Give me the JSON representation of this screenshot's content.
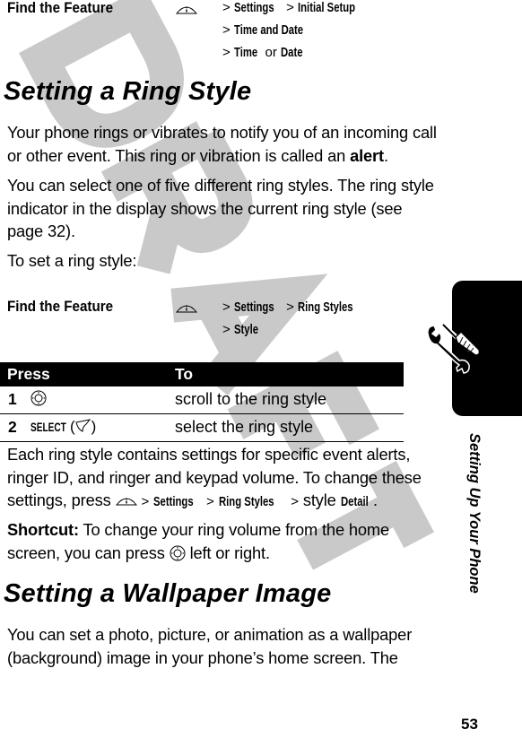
{
  "find_feature_1": {
    "label": "Find the Feature",
    "icon": "menu-key-icon",
    "lines": [
      [
        {
          "t": "gt",
          "v": ">"
        },
        {
          "t": "key",
          "v": "Settings"
        },
        {
          "t": "gt",
          "v": ">"
        },
        {
          "t": "key",
          "v": "Initial Setup"
        }
      ],
      [
        {
          "t": "gt",
          "v": ">"
        },
        {
          "t": "key",
          "v": "Time and Date"
        }
      ],
      [
        {
          "t": "gt",
          "v": ">"
        },
        {
          "t": "key",
          "v": "Time"
        },
        {
          "t": "or",
          "v": "or"
        },
        {
          "t": "key",
          "v": "Date"
        }
      ]
    ]
  },
  "section_ring": {
    "heading": "Setting a Ring Style",
    "para1_text": "Your phone rings or vibrates to notify you of an incoming call or other event. This ring or vibration is called an ",
    "para1_bold": "alert",
    "para1_end": ".",
    "para2": "You can select one of five different ring styles. The ring style indicator in the display shows the current ring style (see page 32).",
    "para3": "To set a ring style:"
  },
  "find_feature_2": {
    "label": "Find the Feature",
    "icon": "menu-key-icon",
    "lines": [
      [
        {
          "t": "gt",
          "v": ">"
        },
        {
          "t": "key",
          "v": "Settings"
        },
        {
          "t": "gt",
          "v": ">"
        },
        {
          "t": "key",
          "v": "Ring Styles"
        }
      ],
      [
        {
          "t": "gt",
          "v": ">"
        },
        {
          "t": "key",
          "v": "Style"
        }
      ]
    ]
  },
  "table": {
    "headers": [
      "Press",
      "To"
    ],
    "rows": [
      {
        "num": "1",
        "press_icon": "nav-key-icon",
        "press_label": "",
        "to": "scroll to the ring style"
      },
      {
        "num": "2",
        "press_icon": "right-soft-key-icon",
        "press_label": "SELECT",
        "to": "select the ring style"
      }
    ]
  },
  "para4": {
    "text1": "Each ring style contains settings for specific event alerts, ringer ID, and ringer and keypad volume. To change these settings, press",
    "path": [
      "Settings",
      "Ring Styles"
    ],
    "text2": "style",
    "key_end": "Detail",
    "end": "."
  },
  "shortcut": {
    "label": "Shortcut:",
    "text1": "To change your ring volume from the home screen, you can press",
    "text2": "left or right."
  },
  "section_wallpaper": {
    "heading": "Setting a Wallpaper Image",
    "para": "You can set a photo, picture, or animation as a wallpaper (background) image in your phone’s home screen. The"
  },
  "side_tab": {
    "title": "Setting Up Your Phone",
    "icon": "tools-icon"
  },
  "page_number": "53",
  "watermark": "DRAFT"
}
